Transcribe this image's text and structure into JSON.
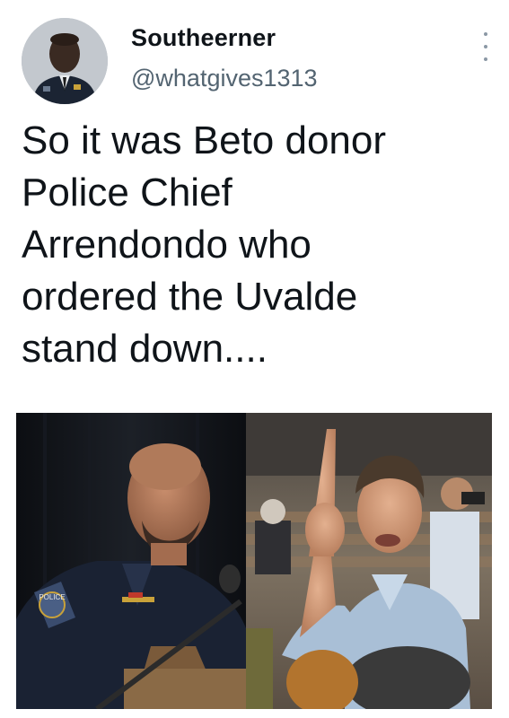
{
  "tweet": {
    "author": {
      "display_name": "Southeerner",
      "handle": "@whatgives1313",
      "avatar_icon": "user-avatar"
    },
    "text": "So it was Beto donor\nPolice Chief\nArrendondo who\nordered the Uvalde\nstand down....",
    "menu_icon": "more-vertical-icon",
    "media": [
      {
        "id": "left",
        "description_icon": "photo-police-chief",
        "patch_text": "POLICE"
      },
      {
        "id": "right",
        "description_icon": "photo-speaker-pointing"
      }
    ]
  },
  "colors": {
    "text_primary": "#0f1419",
    "text_secondary": "#536471",
    "background": "#ffffff"
  }
}
